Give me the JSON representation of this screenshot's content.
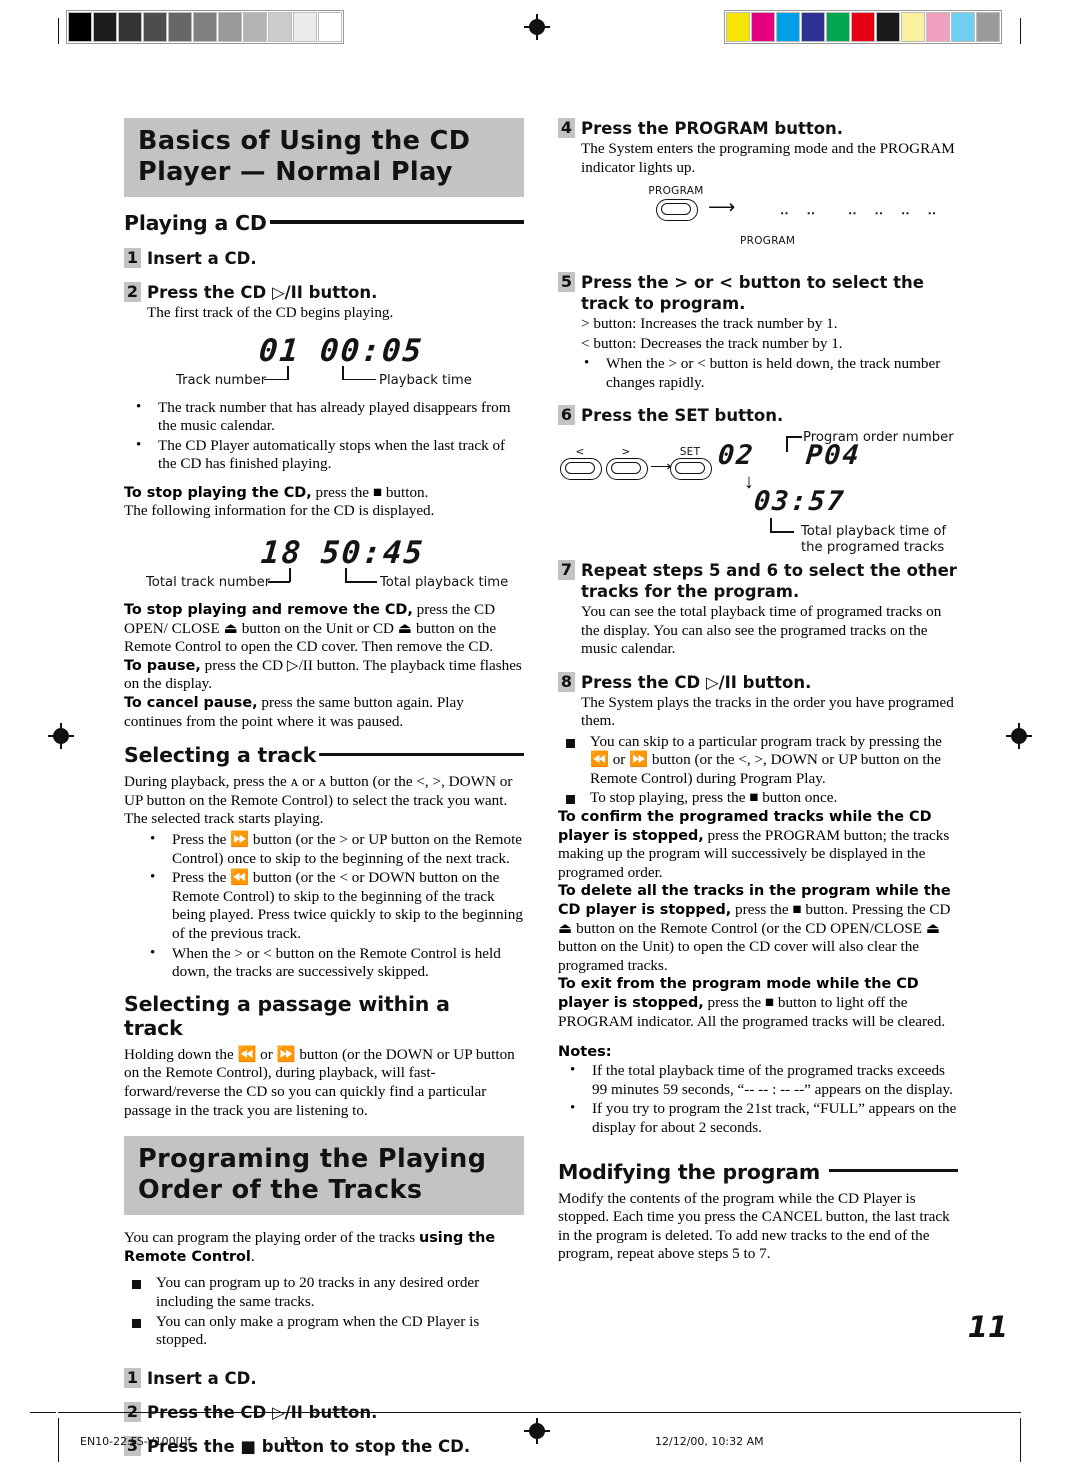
{
  "page": {
    "folio": "11",
    "footer": {
      "file": "EN10-22.FS-V100[J]f",
      "page": "11",
      "date": "12/12/00, 10:32 AM"
    }
  },
  "colorbars": {
    "gray_swatches": [
      "#000000",
      "#1c1c1c",
      "#333333",
      "#4d4d4d",
      "#666666",
      "#808080",
      "#999999",
      "#b3b3b3",
      "#cccccc",
      "#ebebeb",
      "#ffffff"
    ],
    "color_swatches": [
      "#f7e600",
      "#e5007f",
      "#00a0e9",
      "#2e3192",
      "#00a650",
      "#e60012",
      "#1a1a1a",
      "#fbf0a0",
      "#f2a0c0",
      "#6fcff0",
      "#9a9a9a"
    ]
  },
  "left_column": {
    "banner": "Basics of Using the CD Player — Normal Play",
    "section_playing": {
      "title": "Playing a CD",
      "steps": [
        {
          "num": "1",
          "title": "Insert a CD.",
          "body": ""
        },
        {
          "num": "2",
          "title_pre": "Press the CD ",
          "title_glyph": "▷/II",
          "title_post": " button.",
          "body": "The first track of the CD begins playing."
        }
      ],
      "display_1": {
        "track": "01",
        "time": "00:05",
        "label_left": "Track number",
        "label_right": "Playback time"
      },
      "bullets": [
        "The track number that has already played disappears from the music calendar.",
        "The CD Player automatically stops when the last track of the CD has finished playing."
      ],
      "stop_lead": "To stop playing the CD,",
      "stop_rest": " press the ■ button.",
      "stop_follow": "The following information for the CD is displayed.",
      "display_2": {
        "tracks": "18",
        "time": "50:45",
        "label_left": "Total track number",
        "label_right": "Total playback time"
      },
      "remove_lead": "To stop playing and remove the CD,",
      "remove_rest": " press the CD OPEN/ CLOSE ⏏ button on the Unit or CD ⏏ button on the Remote Control to open the CD cover. Then remove the CD.",
      "pause_lead": "To pause,",
      "pause_rest": " press the CD ▷/II button. The playback time flashes on the display.",
      "cancel_lead": "To cancel pause,",
      "cancel_rest": " press the same button again. Play continues from the point where it was paused."
    },
    "section_track": {
      "title": "Selecting a track",
      "intro": "During playback, press the ᴀ or ᴀ button (or the <, >, DOWN or UP button on the Remote Control) to select the track you want. The selected track starts playing.",
      "intro_parts": {
        "a": "During playback, press the ",
        "glyph1": "⏪",
        "b": " or ",
        "glyph2": "⏩",
        "c": " button (or the <, >, DOWN or UP button on the Remote Control) to select the track you want. The selected track starts playing."
      },
      "bullets": [
        "Press the ⏩ button (or the > or UP button on the Remote Control) once to skip to the beginning of the next track.",
        "Press the ⏪ button (or the < or DOWN button on the Remote Control) to skip to the beginning of the track being played. Press twice quickly to skip to the beginning of the previous track.",
        "When the > or < button on the Remote Control is held down, the tracks are successively skipped."
      ]
    },
    "section_passage": {
      "title": "Selecting a passage within a track",
      "body": "Holding down the ⏪ or ⏩ button (or the DOWN or UP button on the Remote Control), during playback, will fast-forward/reverse the CD so you can quickly find a particular passage in the track you are listening to."
    },
    "banner2": "Programing the Playing Order of the Tracks",
    "program_intro_a": "You can program the playing order of the tracks ",
    "program_intro_b": "using the Remote Control",
    "program_intro_c": ".",
    "program_bullets": [
      "You can program up to 20 tracks in any desired order including the same tracks.",
      "You can only make a program when the CD Player is stopped."
    ],
    "program_steps": [
      {
        "num": "1",
        "title": "Insert a CD."
      },
      {
        "num": "2",
        "title_pre": "Press the CD ",
        "title_glyph": "▷/II",
        "title_post": " button."
      },
      {
        "num": "3",
        "title_pre": "Press the ",
        "title_glyph": "■",
        "title_post": " button to stop the CD."
      }
    ]
  },
  "right_column": {
    "step4": {
      "num": "4",
      "title": "Press the PROGRAM button.",
      "body": "The System enters the programing mode and the PROGRAM indicator lights up.",
      "diagram": {
        "button_label": "PROGRAM",
        "indicator_label": "PROGRAM",
        "segments_left": "‥ ‥",
        "segments_right": "‥ ‥ ‥ ‥"
      }
    },
    "step5": {
      "num": "5",
      "title": "Press the > or < button to select the track to program.",
      "lines": [
        "> button:  Increases the track number by 1.",
        "< button:  Decreases the track number by 1."
      ],
      "bullet": "When the > or < button is held down, the track number changes rapidly."
    },
    "step6": {
      "num": "6",
      "title": "Press the SET button.",
      "diagram": {
        "btn_lt": "<",
        "btn_gt": ">",
        "btn_set": "SET",
        "track": "02",
        "program_order": "P04",
        "total_time": "03:57",
        "label_order": "Program order number",
        "label_total": "Total playback time of the programed tracks"
      }
    },
    "step7": {
      "num": "7",
      "title": "Repeat steps 5 and 6 to select the other tracks for the program.",
      "body": "You can see the total playback time of programed tracks on the display. You can also see the programed tracks on the music calendar."
    },
    "step8": {
      "num": "8",
      "title_pre": "Press the CD ",
      "title_glyph": "▷/II",
      "title_post": " button.",
      "body": "The System plays the tracks in the order you have programed them.",
      "bullets": [
        "You can skip to a particular program track by pressing the ⏪ or ⏩ button (or the <, >, DOWN or UP button on the Remote Control) during Program Play.",
        "To stop playing, press the ■ button once."
      ]
    },
    "confirm_lead": "To confirm the programed tracks while the CD player is stopped,",
    "confirm_rest": " press the PROGRAM button; the tracks making up the program will successively be displayed in the programed order.",
    "delete_lead": "To delete all the tracks in the program while the CD player is stopped,",
    "delete_rest": " press the ■ button. Pressing the CD ⏏ button on the Remote Control (or the CD OPEN/CLOSE ⏏ button on the Unit) to open the CD cover will also clear the programed tracks.",
    "exit_lead": "To exit from the program mode while the CD player is stopped,",
    "exit_rest": " press the ■ button to light off the PROGRAM indicator. All the programed tracks will be cleared.",
    "notes_title": "Notes:",
    "notes": [
      "If the total playback time of the programed tracks exceeds 99 minutes 59 seconds, “-- -- : -- --” appears on the display.",
      "If you try to program the 21st track, “FULL” appears on the display for about 2 seconds."
    ],
    "section_modify": {
      "title": "Modifying the program",
      "body": "Modify the contents of the program while the CD Player is stopped. Each time you press the CANCEL button, the last track in the program is deleted. To add new tracks to the end of the program, repeat above steps 5 to 7."
    }
  }
}
